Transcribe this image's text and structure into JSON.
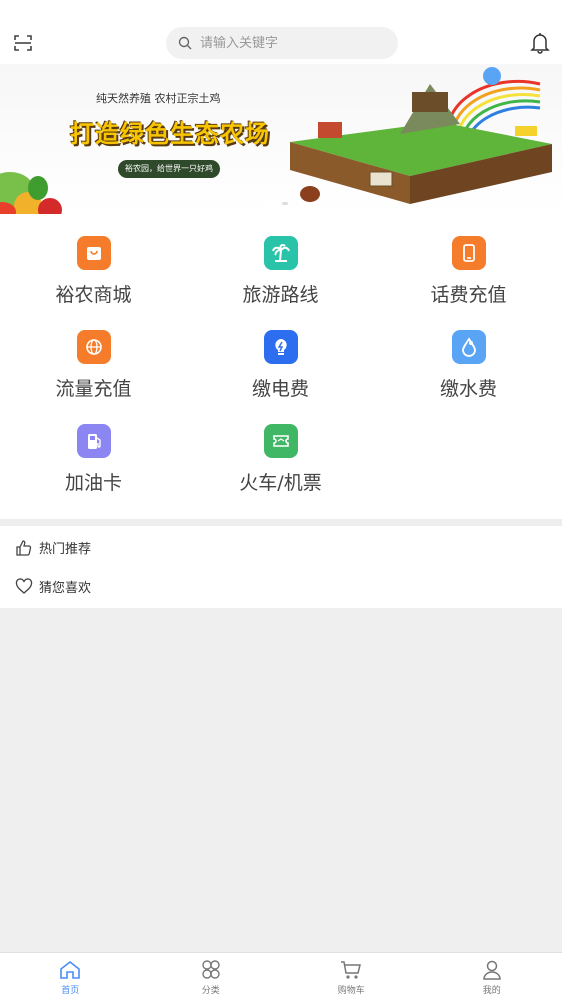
{
  "header": {
    "search_placeholder": "请输入关键字",
    "scan_icon": "scan-icon",
    "bell_icon": "bell-icon"
  },
  "banner": {
    "subtitle": "纯天然养殖 农村正宗土鸡",
    "title": "打造绿色生态农场",
    "tagline": "裕农园，给世界一只好鸡"
  },
  "services": [
    {
      "label": "裕农商城",
      "icon": "bag-icon",
      "color": "#f57c2a"
    },
    {
      "label": "旅游路线",
      "icon": "palm-tree-icon",
      "color": "#28c3a8"
    },
    {
      "label": "话费充值",
      "icon": "phone-icon",
      "color": "#f57c2a"
    },
    {
      "label": "流量充值",
      "icon": "data-globe-icon",
      "color": "#f57c2a"
    },
    {
      "label": "缴电费",
      "icon": "electricity-icon",
      "color": "#2d6ef0"
    },
    {
      "label": "缴水费",
      "icon": "water-drop-icon",
      "color": "#5aa4f6"
    },
    {
      "label": "加油卡",
      "icon": "fuel-pump-icon",
      "color": "#8b86f2"
    },
    {
      "label": "火车/机票",
      "icon": "ticket-icon",
      "color": "#3fb765"
    }
  ],
  "sections": {
    "hot": "热门推荐",
    "guess": "猜您喜欢"
  },
  "tabbar": [
    {
      "label": "首页",
      "icon": "home-icon",
      "active": true
    },
    {
      "label": "分类",
      "icon": "category-icon",
      "active": false
    },
    {
      "label": "购物车",
      "icon": "cart-icon",
      "active": false
    },
    {
      "label": "我的",
      "icon": "user-icon",
      "active": false
    }
  ],
  "colors": {
    "accent": "#4b8df8"
  }
}
